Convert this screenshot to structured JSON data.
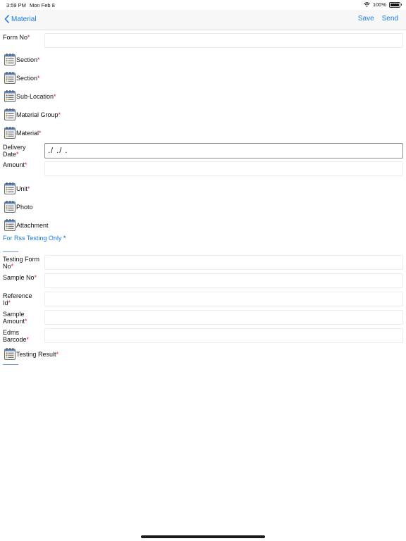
{
  "status": {
    "time": "3:59 PM",
    "date": "Mon Feb 8",
    "battery": "100%"
  },
  "nav": {
    "back_label": "Material",
    "save_label": "Save",
    "send_label": "Send"
  },
  "form": {
    "form_no": "Form No",
    "section1": "Section",
    "section2": "Section",
    "sub_location": "Sub-Location",
    "material_group": "Material Group",
    "material": "Material",
    "delivery_date_line1": "Delivery",
    "delivery_date_line2": "Date",
    "delivery_date_value": "./ ./ .",
    "amount": "Amount",
    "unit": "Unit",
    "photo": "Photo",
    "attachment": "Attachment"
  },
  "testing": {
    "section_title": "For Rss Testing Only",
    "testing_form_no_line1": "Testing Form",
    "testing_form_no_line2": "No",
    "sample_no": "Sample No",
    "reference_id_line1": "Reference",
    "reference_id_line2": "Id",
    "sample_amount_line1": "Sample",
    "sample_amount_line2": "Amount",
    "edms_barcode_line1": "Edms",
    "edms_barcode_line2": "Barcode",
    "testing_result": "Testing Result"
  },
  "required_mark": "*",
  "colors": {
    "accent": "#1a7ae6",
    "required": "#e31b1b"
  }
}
